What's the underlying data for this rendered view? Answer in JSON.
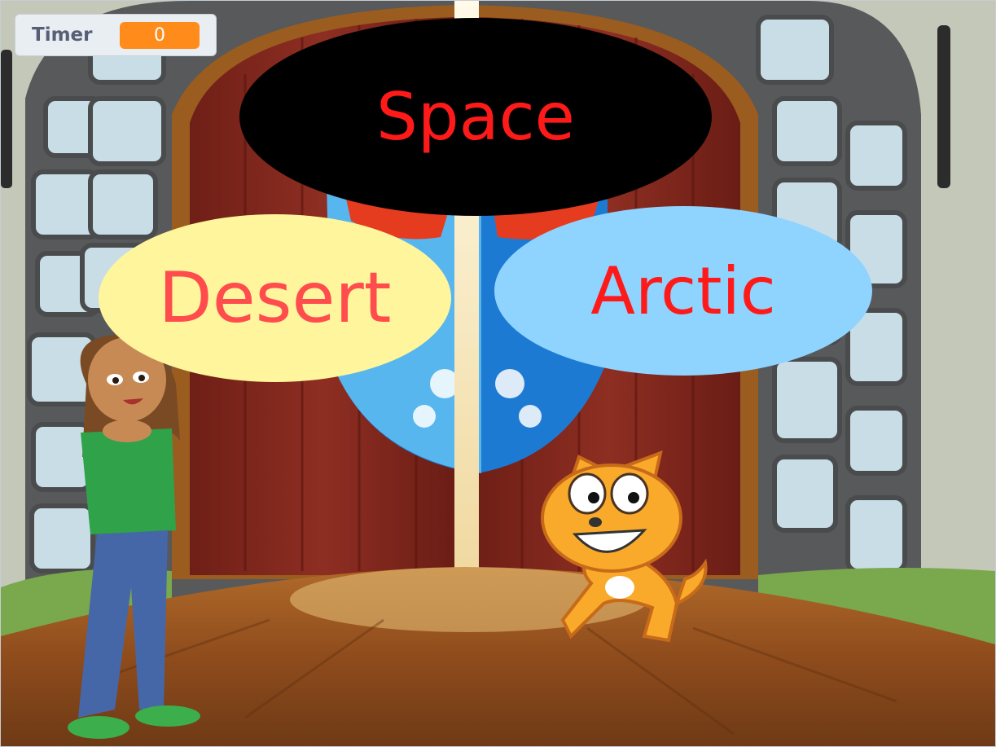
{
  "monitor": {
    "label": "Timer",
    "value": "0"
  },
  "choices": {
    "space": "Space",
    "desert": "Desert",
    "arctic": "Arctic"
  },
  "colors": {
    "monitor_value_bg": "#ff8c1a",
    "space_bubble": "#000000",
    "desert_bubble": "#fff59c",
    "arctic_bubble": "#8fd3ff",
    "choice_text": "#ff1a1a"
  },
  "sprites": [
    "girl-sprite",
    "scratch-cat-sprite"
  ],
  "backdrop": "castle-doors"
}
